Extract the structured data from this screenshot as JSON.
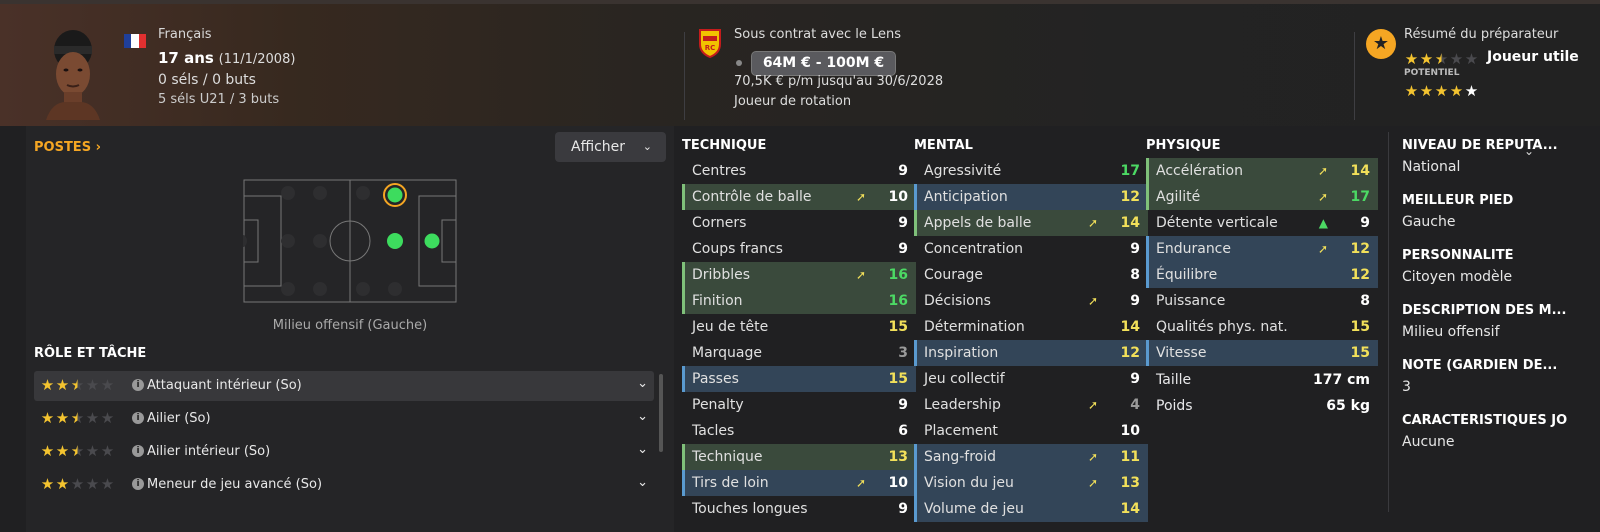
{
  "header": {
    "nationality": "Français",
    "age": "17 ans",
    "birth": "(11/1/2008)",
    "caps": "0 séls / 0 buts",
    "u21": "5 séls U21 / 3 buts",
    "contract": "Sous contrat avec le Lens",
    "value_range": "64M € - 100M €",
    "wage": "70,5K € p/m jusqu'au 30/6/2028",
    "squad_status": "Joueur de rotation",
    "coach_summary": "Résumé du préparateur",
    "coach_verdict": "Joueur utile",
    "potential_label": "POTENTIEL",
    "current_rating": 2.5,
    "potential_rating": 5
  },
  "positions": {
    "title": "POSTES",
    "show_button": "Afficher",
    "caption": "Milieu offensif (Gauche)"
  },
  "roles": {
    "title": "RÔLE ET TÂCHE",
    "items": [
      {
        "label": "Attaquant intérieur (So)",
        "rating": 2.5
      },
      {
        "label": "Ailier (So)",
        "rating": 2.5
      },
      {
        "label": "Ailier intérieur (So)",
        "rating": 2.5
      },
      {
        "label": "Meneur de jeu avancé (So)",
        "rating": 2
      }
    ]
  },
  "technique": {
    "title": "TECHNIQUE",
    "rows": [
      {
        "name": "Centres",
        "value": "9",
        "hl": "",
        "trend": ""
      },
      {
        "name": "Contrôle de balle",
        "value": "10",
        "hl": "green",
        "trend": "up"
      },
      {
        "name": "Corners",
        "value": "9",
        "hl": "",
        "trend": ""
      },
      {
        "name": "Coups francs",
        "value": "9",
        "hl": "",
        "trend": ""
      },
      {
        "name": "Dribbles",
        "value": "16",
        "hl": "green",
        "trend": "up"
      },
      {
        "name": "Finition",
        "value": "16",
        "hl": "green",
        "trend": ""
      },
      {
        "name": "Jeu de tête",
        "value": "15",
        "hl": "",
        "trend": ""
      },
      {
        "name": "Marquage",
        "value": "3",
        "hl": "",
        "trend": ""
      },
      {
        "name": "Passes",
        "value": "15",
        "hl": "blue",
        "trend": ""
      },
      {
        "name": "Penalty",
        "value": "9",
        "hl": "",
        "trend": ""
      },
      {
        "name": "Tacles",
        "value": "6",
        "hl": "",
        "trend": ""
      },
      {
        "name": "Technique",
        "value": "13",
        "hl": "green",
        "trend": ""
      },
      {
        "name": "Tirs de loin",
        "value": "10",
        "hl": "blue",
        "trend": "up"
      },
      {
        "name": "Touches longues",
        "value": "9",
        "hl": "",
        "trend": ""
      }
    ]
  },
  "mental": {
    "title": "MENTAL",
    "rows": [
      {
        "name": "Agressivité",
        "value": "17",
        "hl": "",
        "trend": ""
      },
      {
        "name": "Anticipation",
        "value": "12",
        "hl": "blue",
        "trend": ""
      },
      {
        "name": "Appels de balle",
        "value": "14",
        "hl": "green",
        "trend": "up"
      },
      {
        "name": "Concentration",
        "value": "9",
        "hl": "",
        "trend": ""
      },
      {
        "name": "Courage",
        "value": "8",
        "hl": "",
        "trend": ""
      },
      {
        "name": "Décisions",
        "value": "9",
        "hl": "",
        "trend": "up"
      },
      {
        "name": "Détermination",
        "value": "14",
        "hl": "",
        "trend": ""
      },
      {
        "name": "Inspiration",
        "value": "12",
        "hl": "blue",
        "trend": ""
      },
      {
        "name": "Jeu collectif",
        "value": "9",
        "hl": "",
        "trend": ""
      },
      {
        "name": "Leadership",
        "value": "4",
        "hl": "",
        "trend": "up"
      },
      {
        "name": "Placement",
        "value": "10",
        "hl": "",
        "trend": ""
      },
      {
        "name": "Sang-froid",
        "value": "11",
        "hl": "blue",
        "trend": "up"
      },
      {
        "name": "Vision du jeu",
        "value": "13",
        "hl": "blue",
        "trend": "up"
      },
      {
        "name": "Volume de jeu",
        "value": "14",
        "hl": "blue",
        "trend": ""
      }
    ]
  },
  "physique": {
    "title": "PHYSIQUE",
    "rows": [
      {
        "name": "Accélération",
        "value": "14",
        "hl": "green",
        "trend": "up"
      },
      {
        "name": "Agilité",
        "value": "17",
        "hl": "green",
        "trend": "up"
      },
      {
        "name": "Détente verticale",
        "value": "9",
        "hl": "",
        "trend": "bigup"
      },
      {
        "name": "Endurance",
        "value": "12",
        "hl": "blue",
        "trend": "up"
      },
      {
        "name": "Équilibre",
        "value": "12",
        "hl": "blue",
        "trend": ""
      },
      {
        "name": "Puissance",
        "value": "8",
        "hl": "",
        "trend": ""
      },
      {
        "name": "Qualités phys. nat.",
        "value": "15",
        "hl": "",
        "trend": ""
      },
      {
        "name": "Vitesse",
        "value": "15",
        "hl": "blue",
        "trend": ""
      }
    ],
    "height_label": "Taille",
    "height": "177 cm",
    "weight_label": "Poids",
    "weight": "65 kg"
  },
  "info": [
    {
      "title": "NIVEAU DE RÉPUTA...",
      "value": "National"
    },
    {
      "title": "MEILLEUR PIED",
      "value": "Gauche"
    },
    {
      "title": "PERSONNALITÉ",
      "value": "Citoyen modèle"
    },
    {
      "title": "DESCRIPTION DES M...",
      "value": "Milieu offensif"
    },
    {
      "title": "NOTE (GARDIEN DE...",
      "value": "3"
    },
    {
      "title": "CARACTÉRISTIQUES JO",
      "value": "Aucune"
    }
  ],
  "colors": {
    "accent_orange": "#f5a623",
    "value_green": "#4cd964",
    "value_yellow": "#f2e05a",
    "value_grey": "#9a9a9a",
    "highlight_green": "#3a4a3c",
    "highlight_blue": "#334558"
  }
}
